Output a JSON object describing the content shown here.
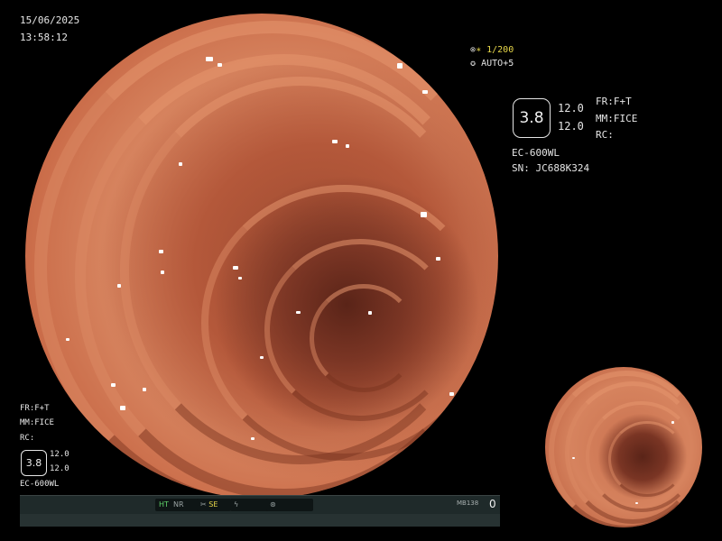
{
  "overlay_top_left": {
    "date": "15/06/2025",
    "time": "13:58:12"
  },
  "overlay_top_right": {
    "shutter_line": "∗ 1/200",
    "auto_line": "AUTO+5"
  },
  "panel_right": {
    "zoom_value": "3.8",
    "value_top": "12.0",
    "value_bottom": "12.0",
    "fr": "FR:F+T",
    "mm": "MM:FICE",
    "rc": "RC:",
    "model": "EC-600WL",
    "serial": "SN: JC688K324"
  },
  "panel_bottom_left": {
    "fr": "FR:F+T",
    "mm": "MM:FICE",
    "rc": "RC:",
    "zoom_value": "3.8",
    "value_top": "12.0",
    "value_bottom": "12.0",
    "model": "EC-600WL"
  },
  "status_bar": {
    "ht": "HT",
    "nr": "NR",
    "se": "SE",
    "code": "MB138",
    "counter": "0"
  },
  "colors": {
    "mucosa": "#d6835e",
    "lumen": "#5a2418",
    "status_green": "#5fd36a",
    "status_yellow": "#e8d84a"
  }
}
